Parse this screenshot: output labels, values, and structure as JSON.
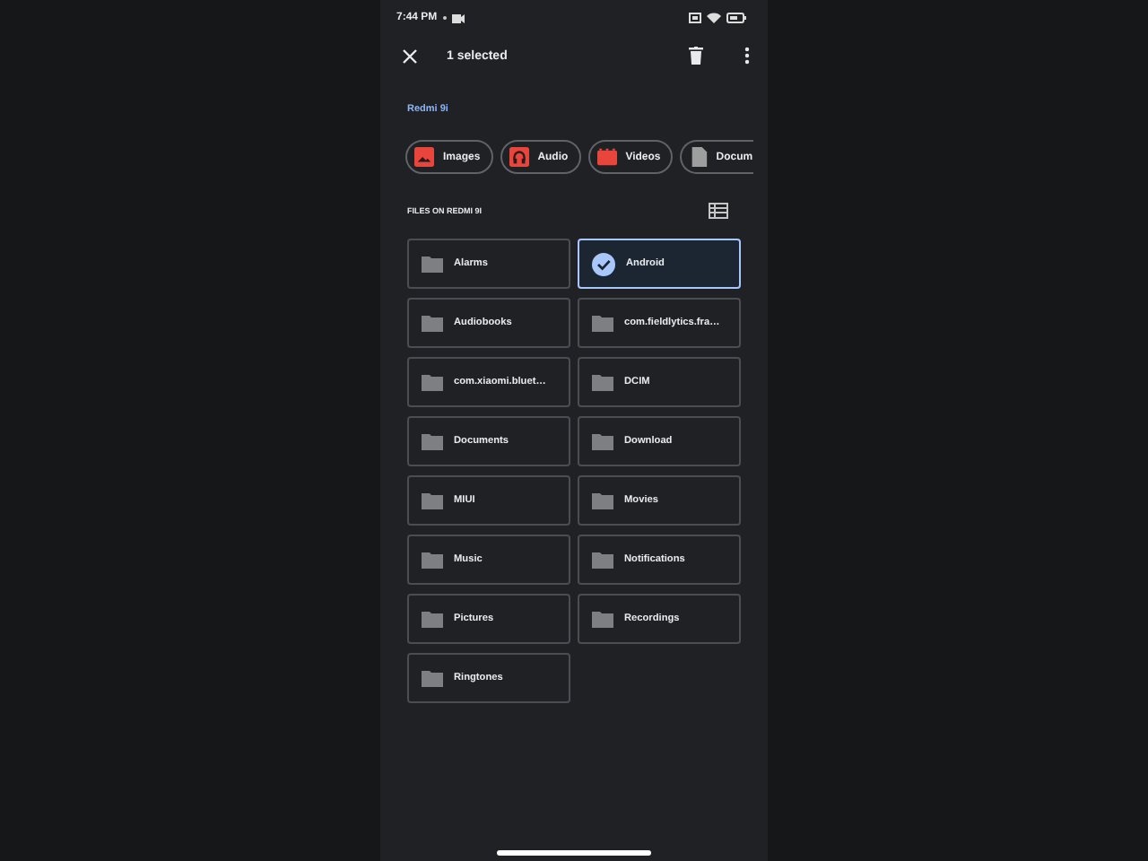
{
  "status_bar": {
    "time": "7:44 PM"
  },
  "toolbar": {
    "title": "1 selected"
  },
  "breadcrumb": "Redmi 9i",
  "categories": [
    {
      "label": "Images",
      "kind": "images"
    },
    {
      "label": "Audio",
      "kind": "audio"
    },
    {
      "label": "Videos",
      "kind": "videos"
    },
    {
      "label": "Docum",
      "kind": "documents"
    }
  ],
  "section_title": "FILES ON REDMI 9I",
  "folders": [
    {
      "name": "Alarms",
      "selected": false
    },
    {
      "name": "Android",
      "selected": true
    },
    {
      "name": "Audiobooks",
      "selected": false
    },
    {
      "name": "com.fieldlytics.fra…",
      "selected": false
    },
    {
      "name": "com.xiaomi.bluet…",
      "selected": false
    },
    {
      "name": "DCIM",
      "selected": false
    },
    {
      "name": "Documents",
      "selected": false
    },
    {
      "name": "Download",
      "selected": false
    },
    {
      "name": "MIUI",
      "selected": false
    },
    {
      "name": "Movies",
      "selected": false
    },
    {
      "name": "Music",
      "selected": false
    },
    {
      "name": "Notifications",
      "selected": false
    },
    {
      "name": "Pictures",
      "selected": false
    },
    {
      "name": "Recordings",
      "selected": false
    },
    {
      "name": "Ringtones",
      "selected": false
    }
  ]
}
